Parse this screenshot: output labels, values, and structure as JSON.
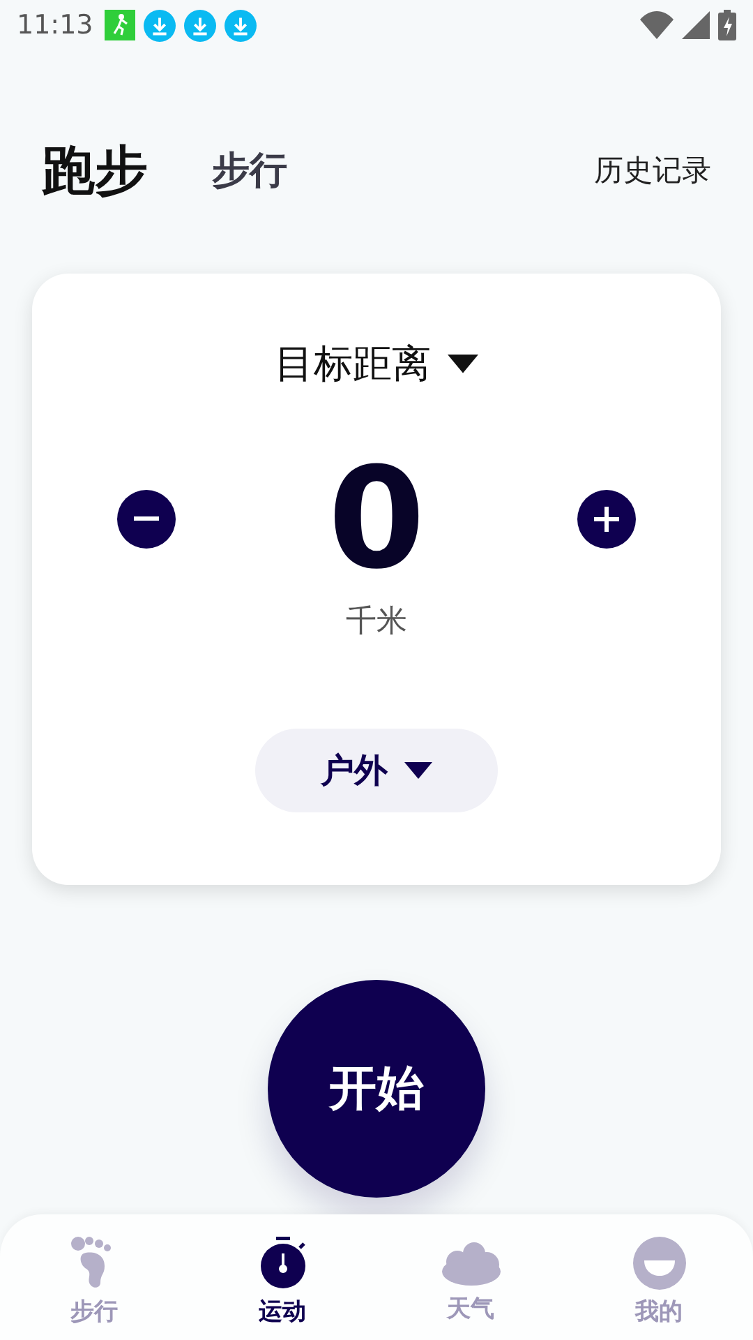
{
  "status_bar": {
    "time": "11:13"
  },
  "tabs": [
    {
      "label": "跑步",
      "selected": true
    },
    {
      "label": "步行",
      "selected": false
    }
  ],
  "history_link": "历史记录",
  "goal_card": {
    "title": "目标距离",
    "value": "0",
    "unit": "千米",
    "mode": "户外"
  },
  "start_button": "开始",
  "bottom_nav": [
    {
      "label": "步行",
      "selected": false
    },
    {
      "label": "运动",
      "selected": true
    },
    {
      "label": "天气",
      "selected": false
    },
    {
      "label": "我的",
      "selected": false
    }
  ]
}
